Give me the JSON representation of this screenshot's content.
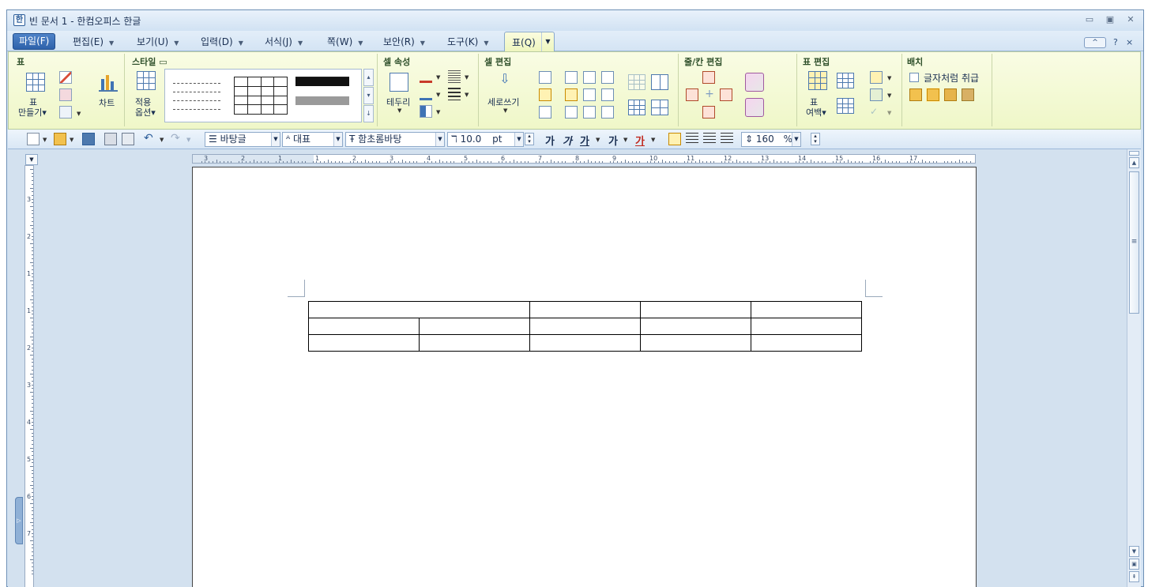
{
  "window": {
    "title": "빈 문서 1 - 한컴오피스 한글",
    "app_icon": "hwp-app-icon"
  },
  "menu": {
    "file": "파일(F)",
    "items": [
      {
        "label": "편집(E)"
      },
      {
        "label": "보기(U)"
      },
      {
        "label": "입력(D)"
      },
      {
        "label": "서식(J)"
      },
      {
        "label": "쪽(W)"
      },
      {
        "label": "보안(R)"
      },
      {
        "label": "도구(K)"
      }
    ],
    "active_tab": "표(Q)",
    "help": "?",
    "close": "×"
  },
  "ribbon": {
    "groups": {
      "table": "표",
      "style": "스타일",
      "cell_props": "셀 속성",
      "cell_edit": "셀 편집",
      "row_col_edit": "줄/칸 편집",
      "table_edit": "표 편집",
      "arrange": "배치"
    },
    "make_table_top": "표",
    "make_table_bottom": "만들기",
    "chart": "차트",
    "apply_top": "적용",
    "apply_bottom": "옵션",
    "border": "테두리",
    "vertical_writing": "세로쓰기",
    "margin_top": "표",
    "margin_bottom": "여백",
    "treat_as_char": "글자처럼 취급"
  },
  "toolbar": {
    "style_combo": "바탕글",
    "char_style_combo": "대표",
    "font_combo": "함초롬바탕",
    "font_size": "10.0",
    "font_unit": "pt",
    "bold": "가",
    "italic": "가",
    "underline": "가",
    "strike": "가",
    "color": "가",
    "line_spacing": "160",
    "line_spacing_unit": "%"
  },
  "ruler": {
    "h_numbers": [
      "3",
      "2",
      "1",
      "1",
      "2",
      "3",
      "4",
      "5",
      "6",
      "7",
      "8",
      "9",
      "10",
      "11",
      "12",
      "13",
      "14",
      "15",
      "16",
      "17"
    ],
    "v_numbers": [
      "3",
      "2",
      "1",
      "1",
      "2",
      "3",
      "4",
      "5",
      "6",
      "7"
    ]
  },
  "document": {
    "table": {
      "rows": 3,
      "cols": 5,
      "first_row_merged_cols": 2
    }
  }
}
